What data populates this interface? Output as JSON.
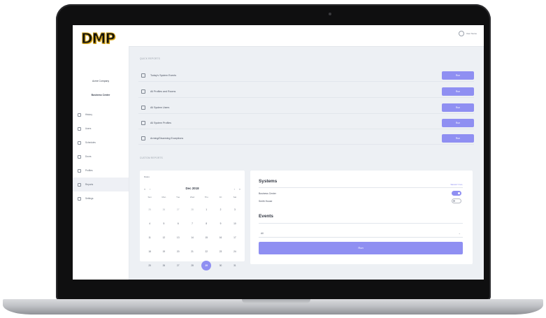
{
  "brand": {
    "logo_text": "DMP",
    "accent": "#8f8ff2"
  },
  "header": {
    "user_label": "User Name"
  },
  "sidebar": {
    "company_name": "Acme Company",
    "dealer_name": "Business Center",
    "items": [
      {
        "label": "History",
        "icon": "history-icon"
      },
      {
        "label": "Users",
        "icon": "users-icon"
      },
      {
        "label": "Schedules",
        "icon": "schedules-icon"
      },
      {
        "label": "Doors",
        "icon": "doors-icon"
      },
      {
        "label": "Profiles",
        "icon": "profiles-icon"
      },
      {
        "label": "Reports",
        "icon": "reports-icon",
        "active": true
      },
      {
        "label": "Settings",
        "icon": "settings-icon"
      }
    ]
  },
  "quick_reports": {
    "section_label": "QUICK REPORTS",
    "run_label": "Run",
    "items": [
      {
        "label": "Today's System Events",
        "icon": "clock-icon"
      },
      {
        "label": "All Profiles and Rooms",
        "icon": "person-icon"
      },
      {
        "label": "All System Users",
        "icon": "user-icon"
      },
      {
        "label": "All System Profiles",
        "icon": "id-card-icon"
      },
      {
        "label": "Arming/Disarming Exceptions",
        "icon": "calendar-icon"
      }
    ]
  },
  "custom_reports": {
    "section_label": "CUSTOM REPORTS",
    "calendar": {
      "label": "Dates",
      "month": "Dec 2018",
      "weekdays": [
        "Sun",
        "Mon",
        "Tue",
        "Wed",
        "Thu",
        "Fri",
        "Sat"
      ],
      "days": [
        "25",
        "26",
        "27",
        "28",
        "1",
        "2",
        "3",
        "4",
        "5",
        "6",
        "7",
        "8",
        "9",
        "10",
        "11",
        "12",
        "13",
        "14",
        "15",
        "16",
        "17",
        "18",
        "19",
        "20",
        "21",
        "22",
        "23",
        "24",
        "25",
        "26",
        "27",
        "28",
        "29",
        "30",
        "31"
      ],
      "muted_days": [
        0,
        1,
        2,
        3
      ],
      "selected_index": 32
    },
    "filters": {
      "systems_title": "Systems",
      "select_all": "SELECT ALL",
      "systems": [
        {
          "label": "Business Center",
          "enabled": true
        },
        {
          "label": "Smith House",
          "enabled": false
        }
      ],
      "events_title": "Events",
      "events_value": "All",
      "run_label": "Run"
    }
  }
}
